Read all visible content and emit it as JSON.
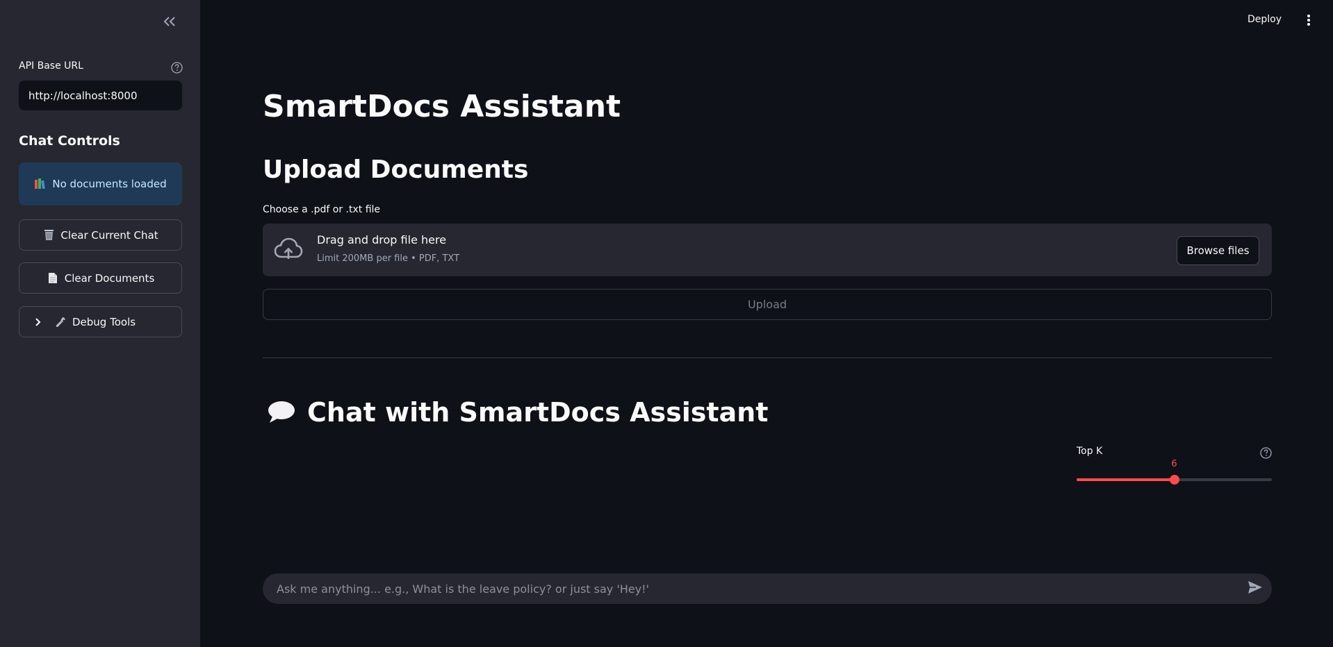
{
  "sidebar": {
    "collapse_icon": "double-chevron-left-icon",
    "api_base_url": {
      "label": "API Base URL",
      "value": "http://localhost:8000",
      "help_icon": "question-circle-icon"
    },
    "chat_controls_heading": "Chat Controls",
    "info_box": {
      "icon": "books-icon",
      "text": "No documents loaded"
    },
    "buttons": [
      {
        "icon": "wastebasket-icon",
        "label": "Clear Current Chat"
      },
      {
        "icon": "page-icon",
        "label": "Clear Documents"
      }
    ],
    "debug_expander": {
      "chevron_icon": "chevron-right-icon",
      "icon": "wrench-icon",
      "label": "Debug Tools"
    }
  },
  "header": {
    "deploy_label": "Deploy",
    "menu_icon": "kebab-menu-icon"
  },
  "main": {
    "title": "SmartDocs Assistant",
    "upload_heading": "Upload Documents",
    "uploader": {
      "label": "Choose a .pdf or .txt file",
      "drop_title": "Drag and drop file here",
      "drop_subtitle": "Limit 200MB per file • PDF, TXT",
      "browse_label": "Browse files",
      "icon": "cloud-upload-icon"
    },
    "upload_button_label": "Upload",
    "chat_heading": "Chat with SmartDocs Assistant",
    "chat_heading_icon": "speech-balloon-icon",
    "top_k": {
      "label": "Top K",
      "value": "6",
      "fraction": 0.5,
      "help_icon": "question-circle-icon"
    },
    "chat_input": {
      "placeholder": "Ask me anything... e.g., What is the leave policy? or just say 'Hey!'",
      "send_icon": "send-icon"
    }
  },
  "colors": {
    "background": "#0e1117",
    "sidebar": "#262730",
    "accent": "#ff4b4b",
    "info_bg": "#1e3a56",
    "info_text": "#c7ebff"
  }
}
